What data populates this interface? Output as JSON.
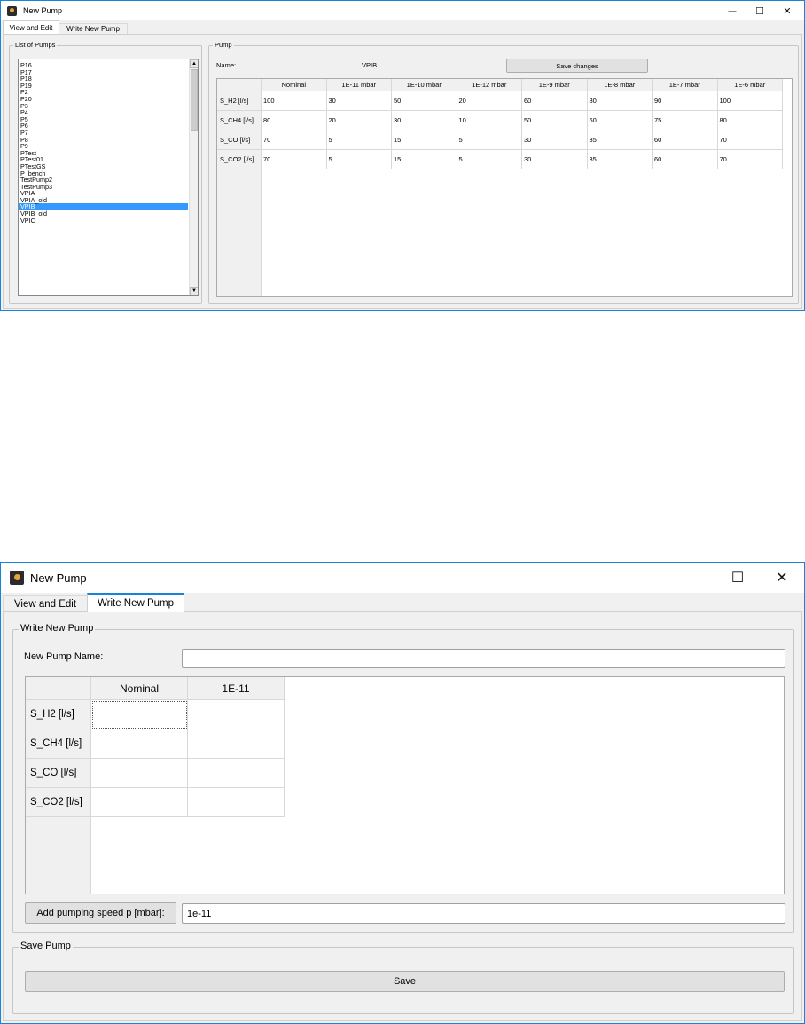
{
  "top": {
    "title": "New Pump",
    "window_controls": {
      "minimize": "—",
      "maximize": "☐",
      "close": "✕"
    },
    "tabs": [
      "View and Edit",
      "Write New Pump"
    ],
    "list_group_label": "List of Pumps",
    "pumps": [
      "P16",
      "P17",
      "P18",
      "P19",
      "P2",
      "P20",
      "P3",
      "P4",
      "P5",
      "P6",
      "P7",
      "P8",
      "P9",
      "PTest",
      "PTest01",
      "PTestGS",
      "P_bench",
      "TestPump2",
      "TestPump3",
      "VPIA",
      "VPIA_old",
      "VPIB",
      "VPIB_old",
      "VPIC"
    ],
    "selected_pump": "VPIB",
    "pump_group_label": "Pump",
    "name_label": "Name:",
    "name_value": "VPIB",
    "save_changes_label": "Save changes",
    "columns": [
      "Nominal",
      "1E-11 mbar",
      "1E-10 mbar",
      "1E-12 mbar",
      "1E-9 mbar",
      "1E-8 mbar",
      "1E-7 mbar",
      "1E-6 mbar"
    ],
    "rows": [
      {
        "label": "S_H2 [l/s]",
        "values": [
          "100",
          "30",
          "50",
          "20",
          "60",
          "80",
          "90",
          "100"
        ]
      },
      {
        "label": "S_CH4 [l/s]",
        "values": [
          "80",
          "20",
          "30",
          "10",
          "50",
          "60",
          "75",
          "80"
        ]
      },
      {
        "label": "S_CO [l/s]",
        "values": [
          "70",
          "5",
          "15",
          "5",
          "30",
          "35",
          "60",
          "70"
        ]
      },
      {
        "label": "S_CO2 [l/s]",
        "values": [
          "70",
          "5",
          "15",
          "5",
          "30",
          "35",
          "60",
          "70"
        ]
      }
    ]
  },
  "bottom": {
    "title": "New Pump",
    "window_controls": {
      "minimize": "—",
      "maximize": "☐",
      "close": "✕"
    },
    "tabs": [
      "View and Edit",
      "Write New Pump"
    ],
    "write_group_label": "Write New Pump",
    "name_label": "New Pump Name:",
    "name_value": "",
    "columns": [
      "Nominal",
      "1E-11"
    ],
    "rows": [
      "S_H2 [l/s]",
      "S_CH4 [l/s]",
      "S_CO [l/s]",
      "S_CO2 [l/s]"
    ],
    "add_speed_label": "Add pumping speed p [mbar]:",
    "add_speed_value": "1e-11",
    "save_group_label": "Save Pump",
    "save_label": "Save"
  },
  "colors": {
    "accent": "#1883d7",
    "selection": "#3399ff",
    "window_bg": "#f0f0f0"
  },
  "icons": {
    "app": "app-icon",
    "scroll_up": "▲",
    "scroll_down": "▼"
  }
}
